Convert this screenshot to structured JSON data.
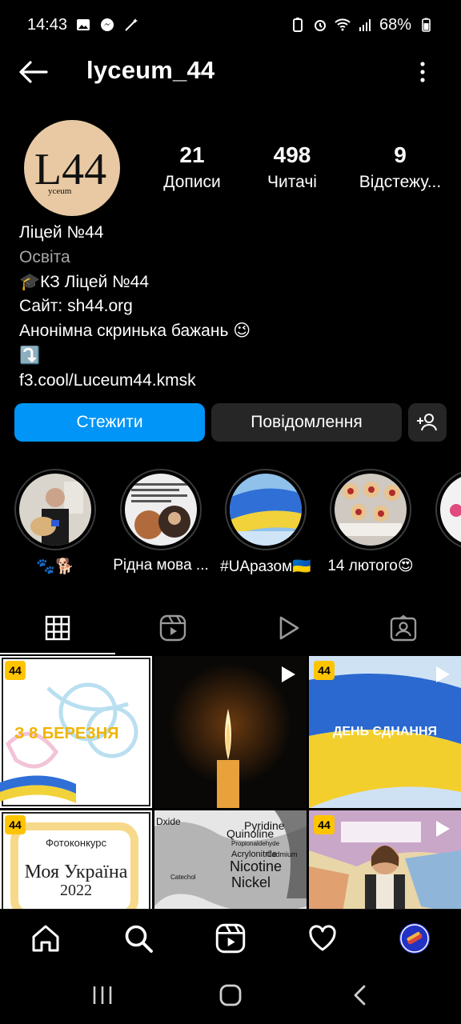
{
  "status_bar": {
    "time": "14:43",
    "battery": "68%"
  },
  "header": {
    "username": "lyceum_44"
  },
  "avatar": {
    "logo_text": "L44",
    "logo_sub": "yceum"
  },
  "stats": [
    {
      "value": "21",
      "label": "Дописи"
    },
    {
      "value": "498",
      "label": "Читачі"
    },
    {
      "value": "9",
      "label": "Відстежу..."
    }
  ],
  "bio": {
    "name": "Ліцей №44",
    "category": "Освіта",
    "line1": "🎓КЗ Ліцей №44",
    "line2": "Сайт: sh44.org",
    "line3": "Анонімна скринька бажань 😉",
    "line4": "⤵️",
    "link": "f3.cool/Luceum44.kmsk"
  },
  "buttons": {
    "follow": "Стежити",
    "message": "Повідомлення"
  },
  "highlights": [
    {
      "label": "🐾🐕"
    },
    {
      "label": "Рідна мова ..."
    },
    {
      "label": "#UAразом🇺🇦"
    },
    {
      "label": "14 лютого😍"
    }
  ],
  "posts": {
    "p1_text": "З 8 БЕРЕЗНЯ",
    "p3_text": "ДЕНЬ ЄДНАННЯ",
    "p4_title": "Фотоконкурс",
    "p4_text1": "Моя Україна",
    "p4_text2": "2022",
    "p5_words": [
      "Quinoline",
      "Pyridine",
      "Nicotine",
      "Nickel",
      "Cadmium",
      "Acrylonitrile",
      "Catechol",
      "Propionaldehyde",
      "Dxide"
    ],
    "badge": "44"
  },
  "colors": {
    "accent": "#0095f6",
    "secondary_button": "#262626",
    "badge": "#ffc400"
  }
}
